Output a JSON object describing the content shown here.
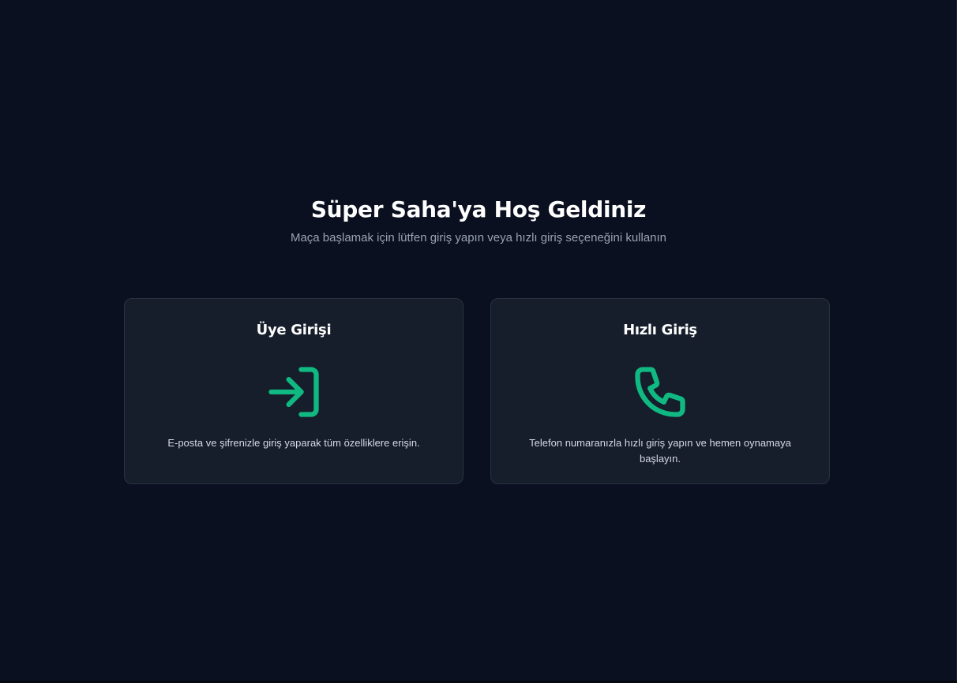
{
  "page": {
    "title": "Süper Saha'ya Hoş Geldiniz",
    "subtitle": "Maça başlamak için lütfen giriş yapın veya hızlı giriş seçeneğini kullanın"
  },
  "cards": [
    {
      "title": "Üye Girişi",
      "icon": "log-in-icon",
      "description": "E-posta ve şifrenizle giriş yaparak tüm özelliklere erişin."
    },
    {
      "title": "Hızlı Giriş",
      "icon": "phone-icon",
      "description": "Telefon numaranızla hızlı giriş yapın ve hemen oynamaya başlayın."
    }
  ],
  "colors": {
    "background": "#0a1020",
    "card": "#161d2b",
    "card_border": "#2a3242",
    "accent": "#10b981",
    "subtitle": "#9aa3b2"
  }
}
